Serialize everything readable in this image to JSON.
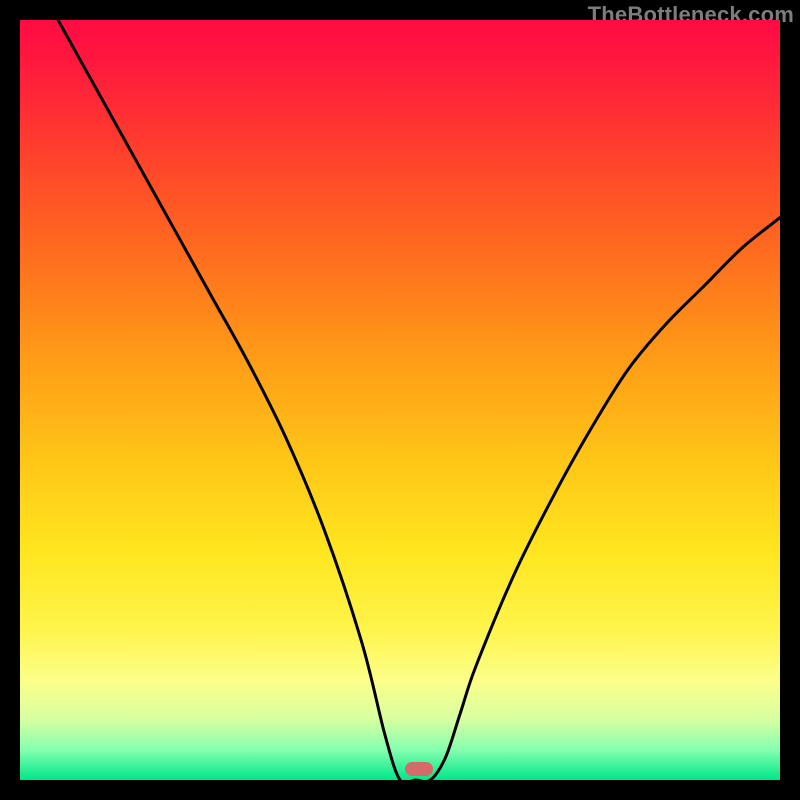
{
  "watermark": "TheBottleneck.com",
  "chart_data": {
    "type": "line",
    "title": "",
    "xlabel": "",
    "ylabel": "",
    "xlim": [
      0,
      100
    ],
    "ylim": [
      0,
      100
    ],
    "grid": false,
    "x": [
      5,
      10,
      15,
      20,
      25,
      30,
      35,
      40,
      45,
      48,
      50,
      52,
      54,
      56,
      58,
      60,
      65,
      70,
      75,
      80,
      85,
      90,
      95,
      100
    ],
    "y": [
      100,
      91,
      82,
      73,
      64,
      55,
      45,
      33,
      18,
      6,
      0,
      0,
      0,
      3,
      9,
      15,
      27,
      37,
      46,
      54,
      60,
      65,
      70,
      74
    ],
    "annotations": [
      {
        "type": "marker",
        "x": 52.5,
        "y": 1.5,
        "color": "#d46a6a"
      }
    ],
    "background": "red-to-green vertical gradient"
  }
}
